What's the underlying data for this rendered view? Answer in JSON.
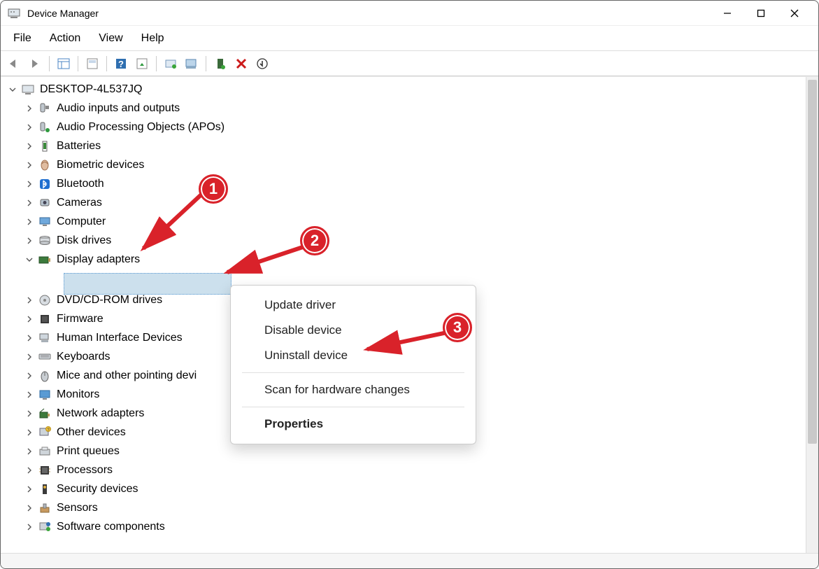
{
  "titlebar": {
    "title": "Device Manager"
  },
  "menubar": {
    "items": [
      "File",
      "Action",
      "View",
      "Help"
    ]
  },
  "tree": {
    "root": "DESKTOP-4L537JQ",
    "categories": [
      "Audio inputs and outputs",
      "Audio Processing Objects (APOs)",
      "Batteries",
      "Biometric devices",
      "Bluetooth",
      "Cameras",
      "Computer",
      "Disk drives",
      "Display adapters",
      "DVD/CD-ROM drives",
      "Firmware",
      "Human Interface Devices",
      "Keyboards",
      "Mice and other pointing devi",
      "Monitors",
      "Network adapters",
      "Other devices",
      "Print queues",
      "Processors",
      "Security devices",
      "Sensors",
      "Software components"
    ],
    "expanded_index": 8
  },
  "context_menu": {
    "items": [
      "Update driver",
      "Disable device",
      "Uninstall device",
      "Scan for hardware changes",
      "Properties"
    ]
  },
  "annotations": {
    "b1": "1",
    "b2": "2",
    "b3": "3"
  }
}
